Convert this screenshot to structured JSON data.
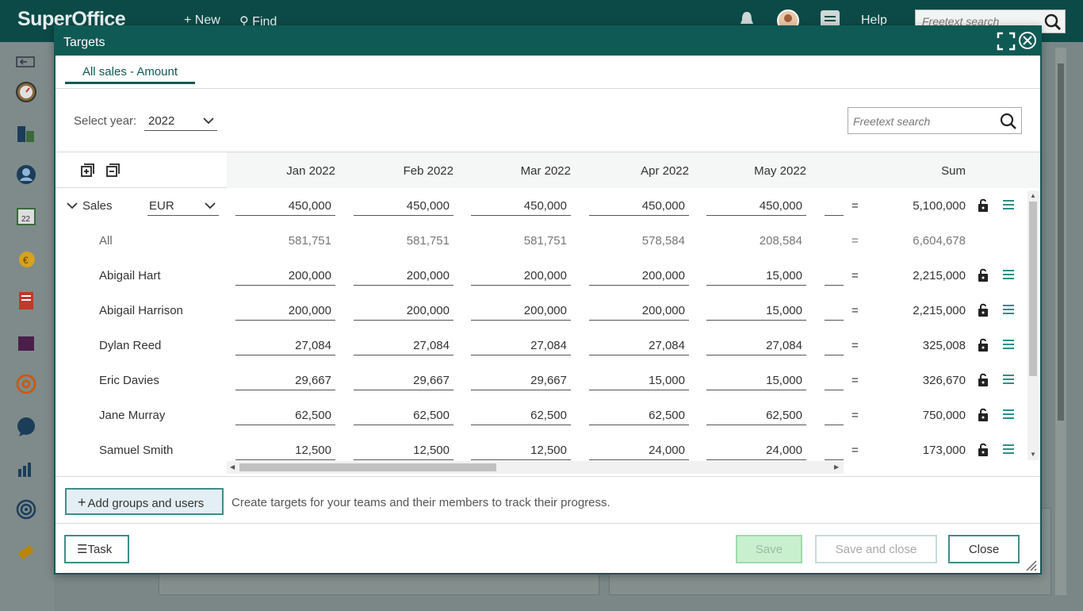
{
  "app": {
    "logo": "SuperOffice",
    "new_label": "New",
    "find_label": "Find",
    "help_label": "Help",
    "search_placeholder": "Freetext search"
  },
  "dialog": {
    "title": "Targets",
    "tab": "All sales - Amount",
    "year_label": "Select year:",
    "year_value": "2022",
    "search_placeholder": "Freetext search",
    "columns": [
      "Jan 2022",
      "Feb 2022",
      "Mar 2022",
      "Apr 2022",
      "May 2022"
    ],
    "sum_header": "Sum",
    "group": {
      "name": "Sales",
      "currency": "EUR"
    },
    "rows": [
      {
        "name": "Sales",
        "values": [
          "450,000",
          "450,000",
          "450,000",
          "450,000",
          "450,000"
        ],
        "eq": "=",
        "sum": "5,100,000"
      },
      {
        "name": "All",
        "values": [
          "581,751",
          "581,751",
          "581,751",
          "578,584",
          "208,584"
        ],
        "eq": "=",
        "sum": "6,604,678"
      },
      {
        "name": "Abigail Hart",
        "values": [
          "200,000",
          "200,000",
          "200,000",
          "200,000",
          "15,000"
        ],
        "eq": "=",
        "sum": "2,215,000"
      },
      {
        "name": "Abigail Harrison",
        "values": [
          "200,000",
          "200,000",
          "200,000",
          "200,000",
          "15,000"
        ],
        "eq": "=",
        "sum": "2,215,000"
      },
      {
        "name": "Dylan Reed",
        "values": [
          "27,084",
          "27,084",
          "27,084",
          "27,084",
          "27,084"
        ],
        "eq": "=",
        "sum": "325,008"
      },
      {
        "name": "Eric Davies",
        "values": [
          "29,667",
          "29,667",
          "29,667",
          "15,000",
          "15,000"
        ],
        "eq": "=",
        "sum": "326,670"
      },
      {
        "name": "Jane Murray",
        "values": [
          "62,500",
          "62,500",
          "62,500",
          "62,500",
          "62,500"
        ],
        "eq": "=",
        "sum": "750,000"
      },
      {
        "name": "Samuel Smith",
        "values": [
          "12,500",
          "12,500",
          "12,500",
          "24,000",
          "24,000"
        ],
        "eq": "=",
        "sum": "173,000"
      }
    ],
    "add_button": "Add groups and users",
    "add_hint": "Create targets for your teams and their members to track their progress.",
    "task_button": "Task",
    "save_button": "Save",
    "save_close_button": "Save and close",
    "close_button": "Close"
  },
  "icons": {
    "lock": "unlock-icon",
    "menu": "hamburger-menu-icon",
    "expand_all": "expand-all-icon",
    "collapse_all": "collapse-all-icon"
  }
}
